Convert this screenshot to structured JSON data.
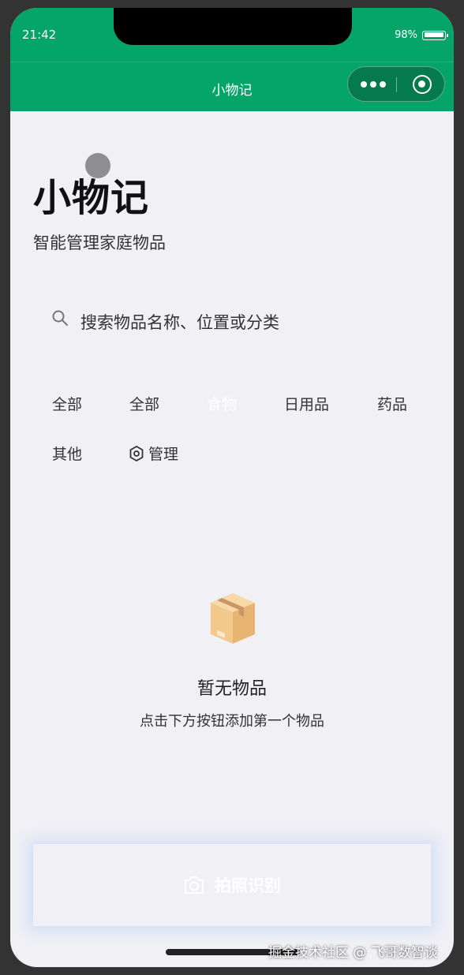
{
  "status_bar": {
    "time": "21:42",
    "battery_percent": "98%"
  },
  "nav": {
    "title": "小物记"
  },
  "header": {
    "title": "小物记",
    "subtitle": "智能管理家庭物品"
  },
  "search": {
    "placeholder": "搜索物品名称、位置或分类"
  },
  "categories": [
    {
      "label": "全部"
    },
    {
      "label": "全部"
    },
    {
      "label": "食物",
      "selected": true
    },
    {
      "label": "日用品"
    },
    {
      "label": "药品"
    },
    {
      "label": "其他"
    },
    {
      "label": "管理"
    }
  ],
  "empty_state": {
    "title": "暂无物品",
    "description": "点击下方按钮添加第一个物品"
  },
  "action": {
    "camera_label": "拍照识别"
  },
  "watermark": "掘金技术社区 @ 飞哥数智谈",
  "colors": {
    "brand": "#05a469",
    "background": "#f0f0f5"
  }
}
